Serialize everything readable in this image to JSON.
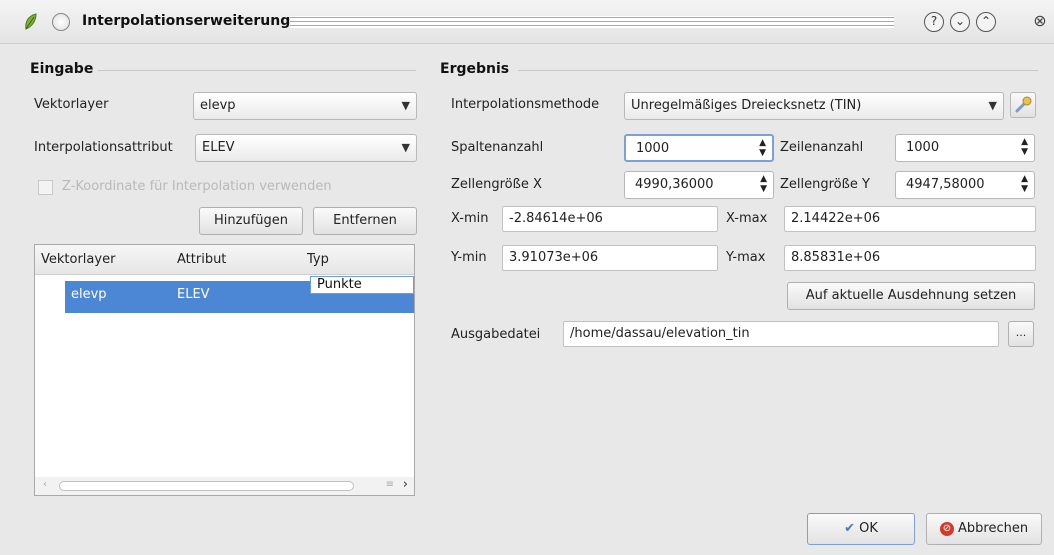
{
  "window": {
    "title": "Interpolationserweiterung"
  },
  "input_group": {
    "title": "Eingabe",
    "vektorlayer_label": "Vektorlayer",
    "vektorlayer_value": "elevp",
    "attribut_label": "Interpolationsattribut",
    "attribut_value": "ELEV",
    "zkoord_label": "Z-Koordinate für Interpolation verwenden",
    "add_button": "Hinzufügen",
    "remove_button": "Entfernen",
    "table": {
      "columns": [
        "Vektorlayer",
        "Attribut",
        "Typ"
      ],
      "rows": [
        {
          "layer": "elevp",
          "attribut": "ELEV",
          "typ": "Punkte"
        }
      ]
    }
  },
  "output_group": {
    "title": "Ergebnis",
    "method_label": "Interpolationsmethode",
    "method_value": "Unregelmäßiges Dreiecksnetz (TIN)",
    "cols_label": "Spaltenanzahl",
    "cols_value": "1000",
    "rows_label": "Zeilenanzahl",
    "rows_value": "1000",
    "cellx_label": "Zellengröße X",
    "cellx_value": "4990,36000",
    "celly_label": "Zellengröße Y",
    "celly_value": "4947,58000",
    "xmin_label": "X-min",
    "xmin_value": "-2.84614e+06",
    "xmax_label": "X-max",
    "xmax_value": "2.14422e+06",
    "ymin_label": "Y-min",
    "ymin_value": "3.91073e+06",
    "ymax_label": "Y-max",
    "ymax_value": "8.85831e+06",
    "extent_button": "Auf aktuelle Ausdehnung setzen",
    "output_label": "Ausgabedatei",
    "output_value": "/home/dassau/elevation_tin",
    "browse_button": "..."
  },
  "footer": {
    "ok_label": "OK",
    "cancel_label": "Abbrechen"
  },
  "colors": {
    "selection": "#4c87d6",
    "focus": "#7ea0d6"
  }
}
